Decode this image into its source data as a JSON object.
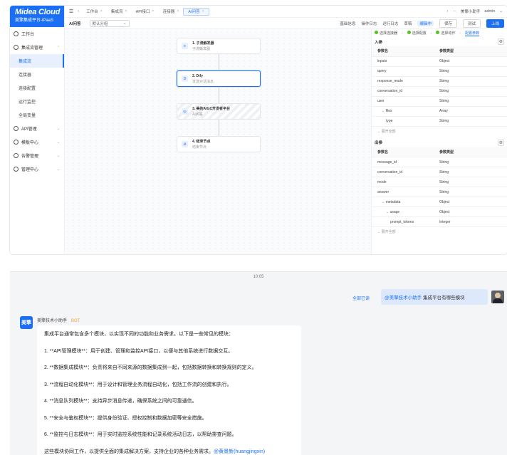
{
  "brand": {
    "logo": "Midea Cloud",
    "sub": "美擎集成平台-iPaaS"
  },
  "sidebar": {
    "items": [
      {
        "label": "工作台",
        "level": 0
      },
      {
        "label": "集成流管理",
        "level": 0,
        "expanded": true
      },
      {
        "label": "集成流",
        "level": 1,
        "active": true
      },
      {
        "label": "连接器",
        "level": 1
      },
      {
        "label": "连接配置",
        "level": 1
      },
      {
        "label": "运行监控",
        "level": 1
      },
      {
        "label": "全局变量",
        "level": 1
      },
      {
        "label": "API管理",
        "level": 0
      },
      {
        "label": "模板中心",
        "level": 0
      },
      {
        "label": "告警管理",
        "level": 0
      },
      {
        "label": "管理中心",
        "level": 0
      }
    ]
  },
  "topbar": {
    "tabs": [
      "工作台",
      "集成流",
      "API接口",
      "连接器",
      "AI问答"
    ],
    "active_tab": "AI问答",
    "assistant": "美擎小助手",
    "user": "admin"
  },
  "toolbar": {
    "title": "AI问答",
    "group_select": "默认分组",
    "actions": [
      "基础信息",
      "操作日志",
      "运行日志"
    ],
    "mode_label": "草稿",
    "mode_badge": "编辑中",
    "buttons": {
      "save": "保存",
      "test": "测试",
      "publish": "上线"
    }
  },
  "flow": {
    "nodes": [
      {
        "title": "1. 子流触发器",
        "sub": "子流触发器",
        "icon": "trigger-icon"
      },
      {
        "title": "2. Dify",
        "sub": "发送对话消息",
        "icon": "dify-icon",
        "selected": true
      },
      {
        "title": "3. 美的AIGC开发者平台",
        "sub": "AI问答",
        "icon": "aigc-icon"
      },
      {
        "title": "4. 结束节点",
        "sub": "结束节点",
        "icon": "end-icon"
      }
    ]
  },
  "panel": {
    "steps": [
      "选择连接器",
      "选择配置",
      "选择动作",
      "配置参数"
    ],
    "input_title": "入参",
    "output_title": "出参",
    "col_name": "参数名",
    "col_type": "参数类型",
    "inputs": [
      {
        "name": "inputs",
        "type": "Object",
        "indent": 0
      },
      {
        "name": "query",
        "type": "String",
        "indent": 0
      },
      {
        "name": "response_mode",
        "type": "String",
        "indent": 0
      },
      {
        "name": "conversation_id",
        "type": "String",
        "indent": 0
      },
      {
        "name": "user",
        "type": "String",
        "indent": 0
      },
      {
        "name": "files",
        "type": "Array",
        "indent": 1,
        "caret": true
      },
      {
        "name": "type",
        "type": "String",
        "indent": 2
      }
    ],
    "outputs": [
      {
        "name": "message_id",
        "type": "String",
        "indent": 0
      },
      {
        "name": "conversation_id",
        "type": "String",
        "indent": 0
      },
      {
        "name": "mode",
        "type": "String",
        "indent": 0
      },
      {
        "name": "answer",
        "type": "String",
        "indent": 0
      },
      {
        "name": "metadata",
        "type": "Object",
        "indent": 1,
        "caret": true
      },
      {
        "name": "usage",
        "type": "Object",
        "indent": 2,
        "caret": true
      },
      {
        "name": "prompt_tokens",
        "type": "Integer",
        "indent": 3
      }
    ],
    "expand_all": "展开全部"
  },
  "chat": {
    "time": "10:05",
    "read_status": "全部已读",
    "question_at": "@美擎技术小助手",
    "question_text": "集成平台有哪些模块",
    "bot_avatar": "美擎",
    "bot_name": "美擎技术小助手",
    "bot_tag": "BOT",
    "answer_lines": [
      "集成平台通常包含多个模块，以实现不同的功能和业务需求。以下是一些常见的模块：",
      "1. **API管理模块**：用于创建、管理和监控API接口，以便与其他系统进行数据交互。",
      "2. **数据集成模块**：负责将来自不同来源的数据集成到一起，包括数据转换和转换规则的定义。",
      "3. **流程自动化模块**：用于设计和管理业务流程自动化，包括工作流的创建和执行。",
      "4. **消息队列模块**：支持异步消息传递，确保系统之间的可靠通信。",
      "5. **安全与鉴权模块**：提供身份验证、授权控制和数据加密等安全措施。",
      "6. **监控与日志模块**：用于实时监控系统性能和记录系统活动日志，以帮助排查问题。"
    ],
    "answer_last": "这些模块协同工作，以提供全面的集成解决方案，支持企业的各种业务需求。",
    "answer_mention": "@黄景新(huangjingxin)"
  }
}
